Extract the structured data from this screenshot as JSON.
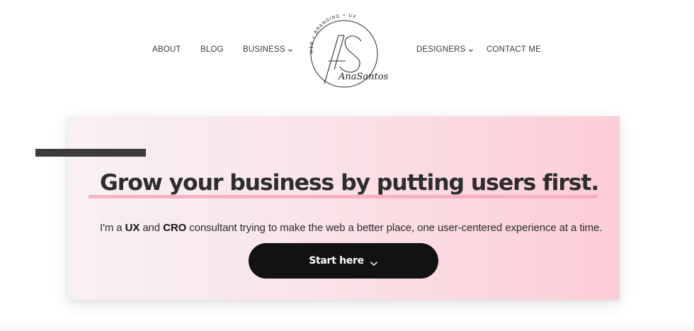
{
  "nav": {
    "items": [
      {
        "label": "ABOUT",
        "has_dropdown": false
      },
      {
        "label": "BLOG",
        "has_dropdown": false
      },
      {
        "label": "BUSINESS",
        "has_dropdown": true
      },
      {
        "label": "DESIGNERS",
        "has_dropdown": true
      },
      {
        "label": "CONTACT ME",
        "has_dropdown": false
      }
    ]
  },
  "logo": {
    "ring_text": "WEB • BRANDING • UX",
    "monogram": "AS",
    "signature": "AnaSantos"
  },
  "hero": {
    "headline": "Grow your business by putting users first.",
    "subline": {
      "prefix": "I'm a ",
      "strong1": "UX",
      "middle": " and ",
      "strong2": "CRO",
      "suffix": " consultant trying to make the web a better place, one user-centered experience at a time."
    },
    "cta_label": "Start here",
    "cta_icon": "chevron-down-icon"
  },
  "colors": {
    "accent_pink": "#f6a9bd",
    "card_gradient_start": "#f8f1f2",
    "card_gradient_end": "#fccdd6",
    "cta_bg": "#121212",
    "accent_bar": "#3b3b3b"
  }
}
